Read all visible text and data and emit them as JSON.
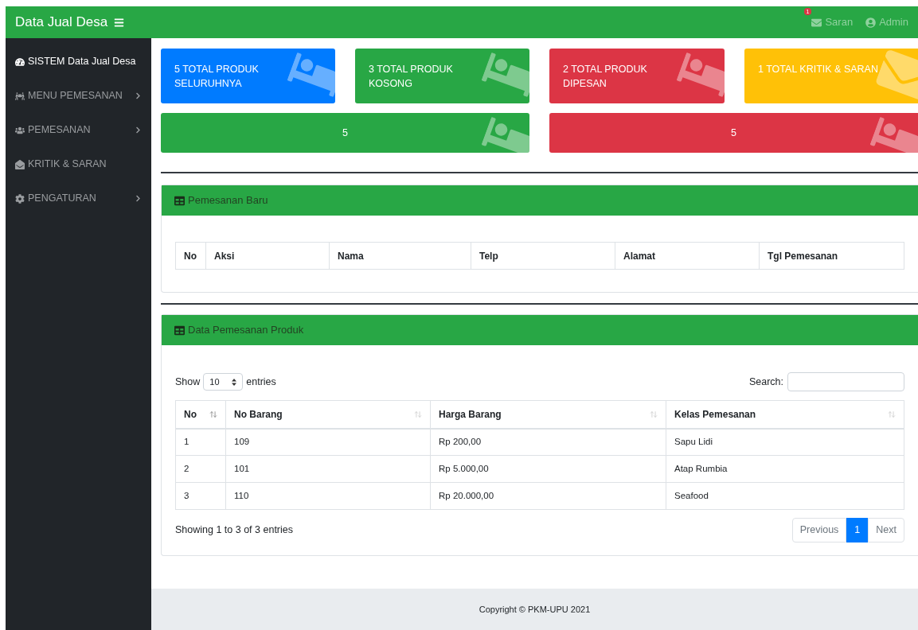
{
  "navbar": {
    "brand": "Data Jual Desa",
    "notification_count": "1",
    "links": [
      {
        "kind": "mail",
        "label": "Saran"
      },
      {
        "kind": "user",
        "label": "Admin"
      }
    ]
  },
  "sidebar": {
    "items": [
      {
        "label": "SISTEM Data Jual Desa",
        "selected": true,
        "has_submenu": false
      },
      {
        "label": "MENU PEMESANAN",
        "selected": false,
        "has_submenu": true
      },
      {
        "label": "PEMESANAN",
        "selected": false,
        "has_submenu": true
      },
      {
        "label": "KRITIK & SARAN",
        "selected": false,
        "has_submenu": false
      },
      {
        "label": "PENGATURAN",
        "selected": false,
        "has_submenu": true
      }
    ]
  },
  "stat_cards": [
    {
      "lines": [
        "5 TOTAL PRODUK",
        "SELURUHNYA"
      ],
      "color": "#007bff",
      "kind": "product"
    },
    {
      "lines": [
        "3 TOTAL PRODUK",
        "KOSONG"
      ],
      "color": "#28a745",
      "kind": "product"
    },
    {
      "lines": [
        "2 TOTAL PRODUK",
        "DIPESAN"
      ],
      "color": "#dc3545",
      "kind": "product"
    },
    {
      "lines": [
        "1 TOTAL KRITIK & SARAN"
      ],
      "color": "#ffc107",
      "kind": "feedback"
    }
  ],
  "count_cards": [
    {
      "value": "5",
      "color": "#28a745"
    },
    {
      "value": "5",
      "color": "#dc3545"
    }
  ],
  "new_orders_panel": {
    "title": "Pemesanan Baru",
    "columns": [
      "No",
      "Aksi",
      "Nama",
      "Telp",
      "Alamat",
      "Tgl Pemesanan"
    ]
  },
  "orders_panel": {
    "title": "Data Pemesanan Produk",
    "show_label": "Show",
    "page_size": "10",
    "entries_label": "entries",
    "search_label": "Search:",
    "columns": [
      "No",
      "No Barang",
      "Harga Barang",
      "Kelas Pemesanan"
    ],
    "rows": [
      [
        "1",
        "109",
        "Rp 200,00",
        "Sapu Lidi"
      ],
      [
        "2",
        "101",
        "Rp 5.000,00",
        "Atap Rumbia"
      ],
      [
        "3",
        "110",
        "Rp 20.000,00",
        "Seafood"
      ]
    ],
    "info": "Showing 1 to 3 of 3 entries",
    "pagination": [
      {
        "label": "Previous",
        "selected": false
      },
      {
        "label": "1",
        "selected": true
      },
      {
        "label": "Next",
        "selected": false
      }
    ]
  },
  "footer": "Copyright © PKM-UPU 2021"
}
